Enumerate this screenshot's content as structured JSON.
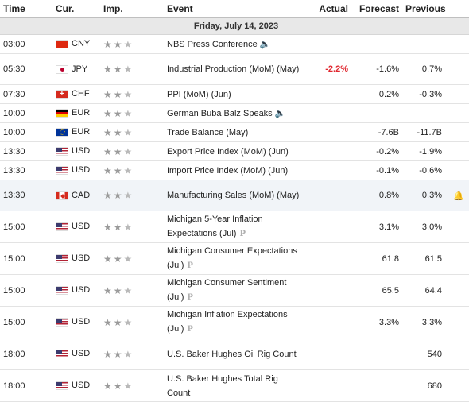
{
  "headers": {
    "time": "Time",
    "cur": "Cur.",
    "imp": "Imp.",
    "event": "Event",
    "actual": "Actual",
    "forecast": "Forecast",
    "previous": "Previous"
  },
  "date_label": "Friday, July 14, 2023",
  "rows": [
    {
      "time": "03:00",
      "flag": "cn",
      "cur": "CNY",
      "event": "NBS Press Conference",
      "actual": "",
      "forecast": "",
      "previous": "",
      "speech": true
    },
    {
      "time": "05:30",
      "flag": "jp",
      "cur": "JPY",
      "event": "Industrial Production (MoM) (May)",
      "actual": "-2.2%",
      "forecast": "-1.6%",
      "previous": "0.7%"
    },
    {
      "time": "07:30",
      "flag": "ch",
      "cur": "CHF",
      "event": "PPI (MoM) (Jun)",
      "actual": "",
      "forecast": "0.2%",
      "previous": "-0.3%"
    },
    {
      "time": "10:00",
      "flag": "de",
      "cur": "EUR",
      "event": "German Buba Balz Speaks",
      "actual": "",
      "forecast": "",
      "previous": "",
      "speech": true
    },
    {
      "time": "10:00",
      "flag": "eu",
      "cur": "EUR",
      "event": "Trade Balance (May)",
      "actual": "",
      "forecast": "-7.6B",
      "previous": "-11.7B"
    },
    {
      "time": "13:30",
      "flag": "us",
      "cur": "USD",
      "event": "Export Price Index (MoM) (Jun)",
      "actual": "",
      "forecast": "-0.2%",
      "previous": "-1.9%"
    },
    {
      "time": "13:30",
      "flag": "us",
      "cur": "USD",
      "event": "Import Price Index (MoM) (Jun)",
      "actual": "",
      "forecast": "-0.1%",
      "previous": "-0.6%"
    },
    {
      "time": "13:30",
      "flag": "ca",
      "cur": "CAD",
      "event": "Manufacturing Sales (MoM) (May)",
      "actual": "",
      "forecast": "0.8%",
      "previous": "0.3%",
      "underline": true,
      "bell": true
    },
    {
      "time": "15:00",
      "flag": "us",
      "cur": "USD",
      "event": "Michigan 5-Year Inflation Expectations (Jul)",
      "actual": "",
      "forecast": "3.1%",
      "previous": "3.0%",
      "prelim": true
    },
    {
      "time": "15:00",
      "flag": "us",
      "cur": "USD",
      "event": "Michigan Consumer Expectations (Jul)",
      "actual": "",
      "forecast": "61.8",
      "previous": "61.5",
      "prelim": true
    },
    {
      "time": "15:00",
      "flag": "us",
      "cur": "USD",
      "event": "Michigan Consumer Sentiment (Jul)",
      "actual": "",
      "forecast": "65.5",
      "previous": "64.4",
      "prelim": true
    },
    {
      "time": "15:00",
      "flag": "us",
      "cur": "USD",
      "event": "Michigan Inflation Expectations (Jul)",
      "actual": "",
      "forecast": "3.3%",
      "previous": "3.3%",
      "prelim": true
    },
    {
      "time": "18:00",
      "flag": "us",
      "cur": "USD",
      "event": "U.S. Baker Hughes Oil Rig Count",
      "actual": "",
      "forecast": "",
      "previous": "540"
    },
    {
      "time": "18:00",
      "flag": "us",
      "cur": "USD",
      "event": "U.S. Baker Hughes Total Rig Count",
      "actual": "",
      "forecast": "",
      "previous": "680"
    }
  ],
  "importance_stars": 3,
  "importance_filled": 2,
  "icons": {
    "speech": "speaker-icon",
    "prelim": "preliminary-p-icon",
    "bell": "alert-bell-icon"
  },
  "colors": {
    "actual_negative": "#e0272f",
    "highlight_row": "#f1f4f8"
  }
}
